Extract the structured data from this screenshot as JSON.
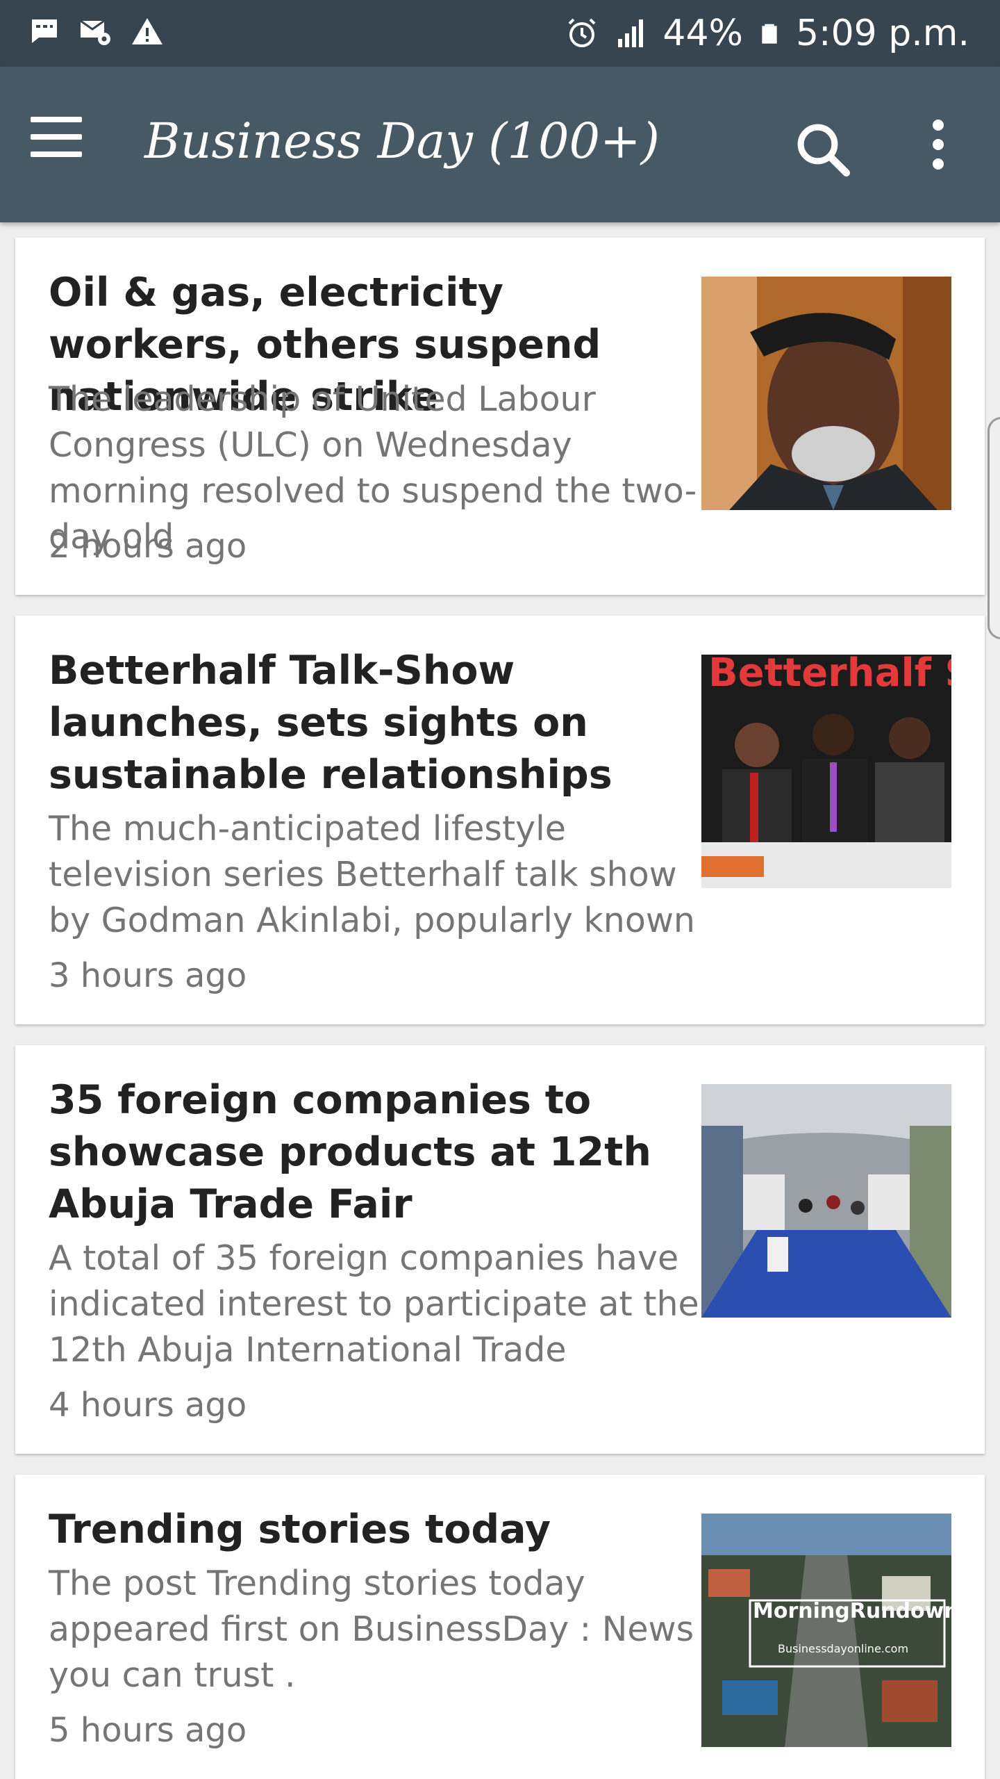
{
  "status_bar": {
    "battery": "44%",
    "time": "5:09 p.m.",
    "icons": [
      "message-icon",
      "mail-settings-icon",
      "warning-icon",
      "alarm-icon",
      "signal-icon",
      "battery-icon"
    ]
  },
  "toolbar": {
    "title": "Business Day (100+)",
    "icons": [
      "menu-icon",
      "search-icon",
      "more-vert-icon"
    ]
  },
  "articles": [
    {
      "title": "Oil & gas, electricity workers, others suspend nationwide strike",
      "summary": "The leadership of United Labour Congress (ULC) on Wednesday morning resolved to suspend the two-day old",
      "time": "2 hours ago"
    },
    {
      "title": "Betterhalf Talk-Show launches, sets sights on sustainable relationships",
      "summary": "The much-anticipated lifestyle television series Betterhalf talk show by Godman Akinlabi, popularly known",
      "time": "3 hours ago",
      "image_text": "Betterhalf SHW"
    },
    {
      "title": "35 foreign companies to showcase products at 12th Abuja Trade Fair",
      "summary": "A total of 35 foreign companies have indicated interest to participate at the 12th Abuja International Trade",
      "time": "4 hours ago"
    },
    {
      "title": "Trending stories today",
      "summary": "The post Trending stories today appeared first on BusinessDay : News you can trust .",
      "time": "5 hours ago",
      "image_text": "MorningRundown",
      "image_subtext": "Businessdayonline.com"
    }
  ],
  "colors": {
    "status_bar": "#36454f",
    "toolbar": "#475964",
    "title_text": "#222222",
    "secondary_text": "#757575"
  }
}
